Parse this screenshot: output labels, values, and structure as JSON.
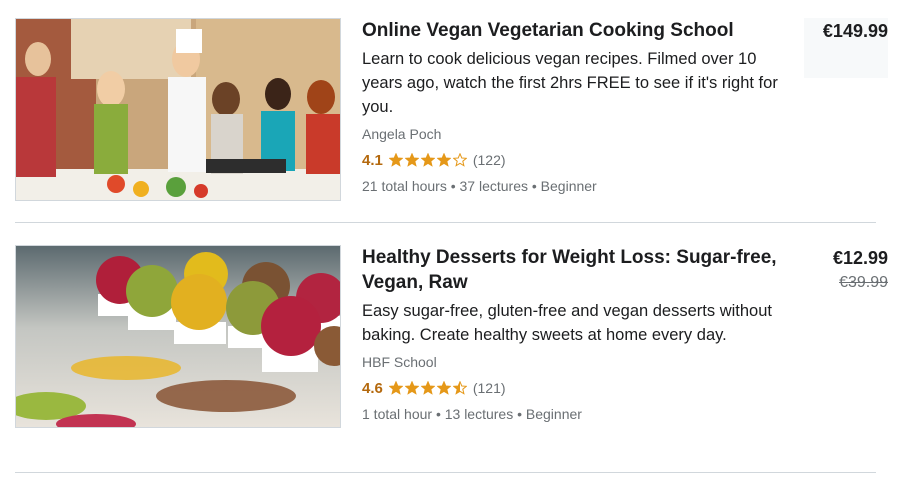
{
  "courses": [
    {
      "title": "Online Vegan Vegetarian Cooking School",
      "description": "Learn to cook delicious vegan recipes. Filmed over 10 years ago, watch the first 2hrs FREE to see if it's right for you.",
      "instructor": "Angela Poch",
      "rating": "4.1",
      "stars": [
        1,
        1,
        1,
        1,
        0
      ],
      "reviews": "(122)",
      "meta": "21 total hours • 37 lectures • Beginner",
      "price": "€149.99",
      "old_price": ""
    },
    {
      "title": "Healthy Desserts for Weight Loss: Sugar-free, Vegan, Raw",
      "description": "Easy sugar-free, gluten-free and vegan desserts without baking. Create healthy sweets at home every day.",
      "instructor": "HBF School",
      "rating": "4.6",
      "stars": [
        1,
        1,
        1,
        1,
        0.5
      ],
      "reviews": "(121)",
      "meta": "1 total hour • 13 lectures • Beginner",
      "price": "€12.99",
      "old_price": "€39.99"
    }
  ],
  "colors": {
    "rating": "#b4690e",
    "star": "#e59819",
    "muted": "#6a6f73",
    "divider": "#d1d7dc"
  }
}
